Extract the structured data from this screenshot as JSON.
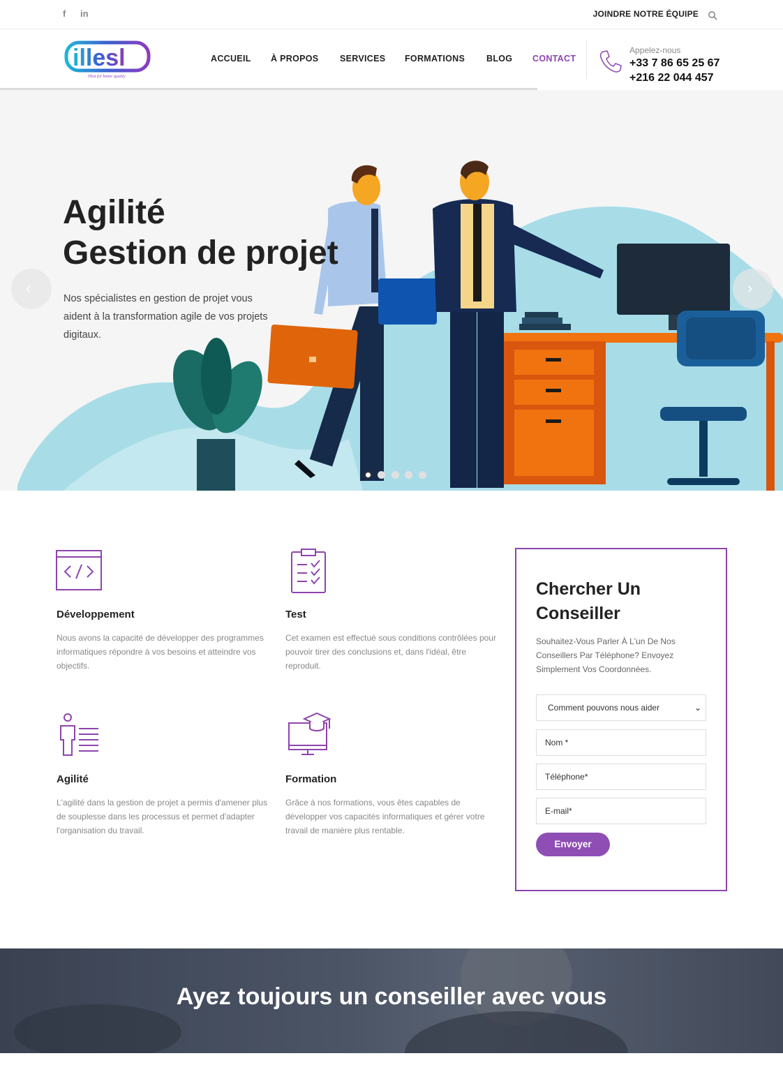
{
  "topbar": {
    "social": [
      {
        "icon": "facebook-icon",
        "label": "f"
      },
      {
        "icon": "linkedin-icon",
        "label": "in"
      }
    ],
    "join_label": "JOINDRE NOTRE ÉQUIPE",
    "search_icon": "search-icon"
  },
  "header": {
    "logo_text": "iTest",
    "logo_tagline": "ITest for better quality",
    "nav": [
      "ACCUEIL",
      "À PROPOS",
      "SERVICES",
      "FORMATIONS",
      "BLOG",
      "CONTACT"
    ],
    "active_nav": "CONTACT",
    "call_label": "Appelez-nous",
    "phones": [
      "+33 7 86 65 25 67",
      "+216 22 044 457"
    ]
  },
  "hero": {
    "title_line1": "Agilité",
    "title_line2": "Gestion de projet",
    "text": "Nos spécialistes en gestion de projet vous aident à la transformation agile de vos projets digitaux.",
    "prev_icon": "chevron-left-icon",
    "next_icon": "chevron-right-icon",
    "slides_count": 5,
    "active_slide": 1
  },
  "services": [
    {
      "icon": "code-icon",
      "title": "Développement",
      "desc": "Nous avons la capacité de développer des programmes informatiques répondre à vos besoins et atteindre vos objectifs."
    },
    {
      "icon": "clipboard-check-icon",
      "title": "Test",
      "desc": "Cet examen est effectué sous conditions contrôlées pour pouvoir tirer des conclusions et, dans l'idéal, être reproduit."
    },
    {
      "icon": "agile-person-icon",
      "title": "Agilité",
      "desc": "L'agilité dans la gestion de projet a permis d'amener plus de souplesse dans les processus et permet d'adapter l'organisation du travail."
    },
    {
      "icon": "training-computer-icon",
      "title": "Formation",
      "desc": "Grâce à nos formations, vous êtes capables de développer vos capacités informatiques et gérer votre travail de manière plus rentable."
    }
  ],
  "form": {
    "title": "Chercher Un Conseiller",
    "desc": "Souhaitez-Vous Parler À L'un De Nos Conseillers Par Téléphone? Envoyez Simplement Vos Coordonnées.",
    "select_value": "Comment pouvons nous aider",
    "name_placeholder": "Nom *",
    "phone_placeholder": "Téléphone*",
    "email_placeholder": "E-mail*",
    "submit_label": "Envoyer"
  },
  "banner": {
    "title": "Ayez toujours un conseiller avec vous"
  },
  "colors": {
    "accent": "#8e44ad",
    "button": "#8e4eb4",
    "hero_bg": "#f5f5f5",
    "blob": "#a8dde8"
  }
}
